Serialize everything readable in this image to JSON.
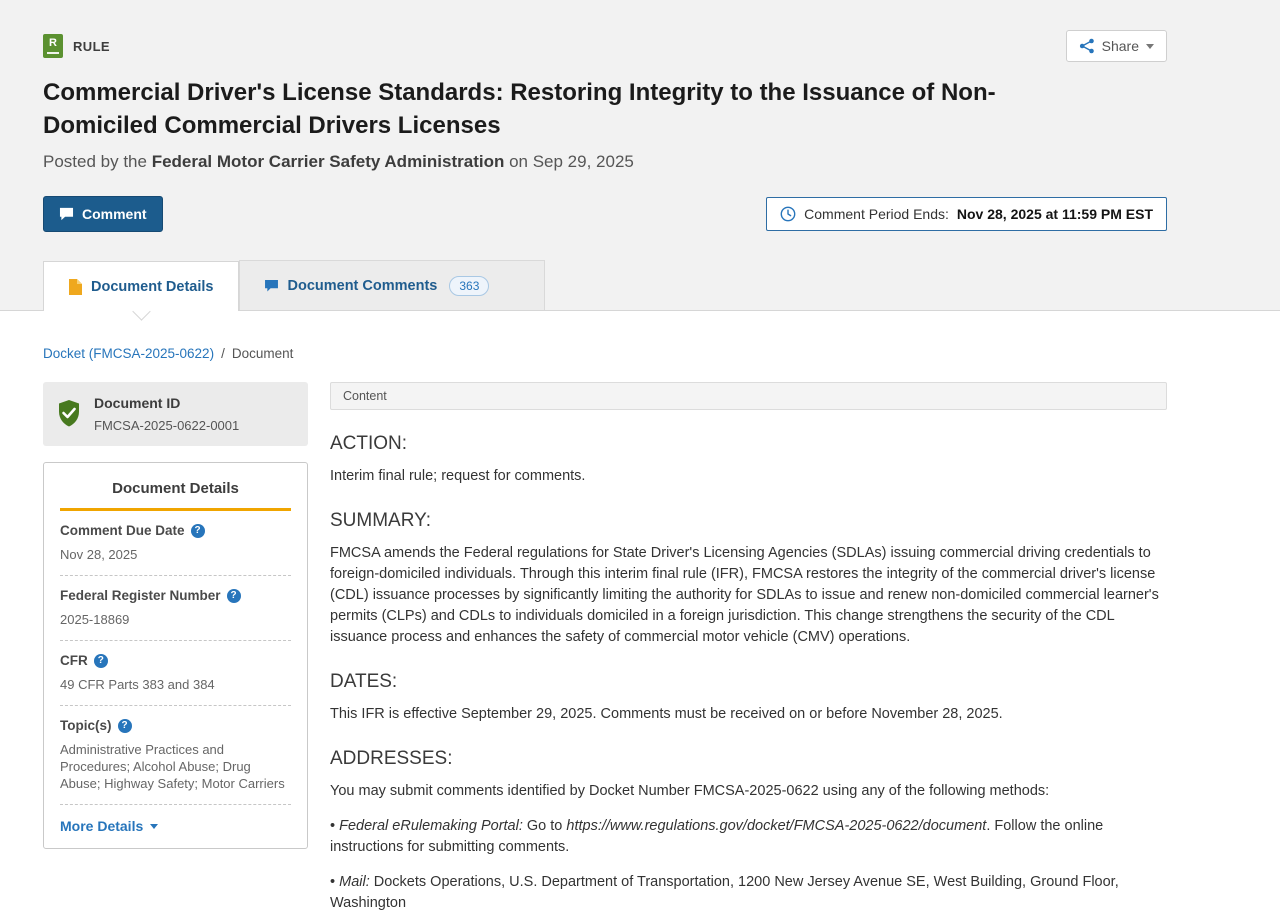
{
  "icons": {
    "help": "?"
  },
  "colors": {
    "accent_blue": "#2775bb",
    "comment_button_blue": "#1c5c8d",
    "rule_icon_green": "#5b9130",
    "shield_green": "#47791f",
    "tab_doc_icon_yellow": "#efa81e",
    "details_accent_orange": "#f0a500",
    "hero_background": "#f2f2f2"
  },
  "header": {
    "type_icon_letter": "R",
    "type_label": "RULE",
    "share_label": "Share",
    "title": "Commercial Driver's License Standards: Restoring Integrity to the Issuance of Non-Domiciled Commercial Drivers Licenses",
    "posted_prefix": "Posted by the ",
    "agency": "Federal Motor Carrier Safety Administration",
    "posted_suffix": " on Sep 29, 2025",
    "comment_button_label": "Comment",
    "comment_period_label": "Comment Period Ends:",
    "comment_period_value": "Nov 28, 2025 at 11:59 PM EST"
  },
  "tabs": {
    "details": {
      "label": "Document Details"
    },
    "comments": {
      "label": "Document Comments",
      "badge": "363"
    }
  },
  "breadcrumb": {
    "docket": "Docket (FMCSA-2025-0622)",
    "separator": "/",
    "current": "Document"
  },
  "sidebar": {
    "document_id": {
      "label": "Document ID",
      "value": "FMCSA-2025-0622-0001"
    },
    "details_title": "Document Details",
    "fields": [
      {
        "label": "Comment Due Date",
        "value": "Nov 28, 2025"
      },
      {
        "label": "Federal Register Number",
        "value": "2025-18869"
      },
      {
        "label": "CFR",
        "value": "49 CFR Parts 383 and 384"
      },
      {
        "label": "Topic(s)",
        "value": "Administrative Practices and Procedures; Alcohol Abuse; Drug Abuse; Highway Safety; Motor Carriers"
      }
    ],
    "more_details_label": "More Details"
  },
  "content": {
    "panel_title": "Content",
    "action": {
      "heading": "ACTION:",
      "body": "Interim final rule; request for comments."
    },
    "summary": {
      "heading": "SUMMARY:",
      "body": "FMCSA amends the Federal regulations for State Driver's Licensing Agencies (SDLAs) issuing commercial driving credentials to foreign-domiciled individuals. Through this interim final rule (IFR), FMCSA restores the integrity of the commercial driver's license (CDL) issuance processes by significantly limiting the authority for SDLAs to issue and renew non-domiciled commercial learner's permits (CLPs) and CDLs to individuals domiciled in a foreign jurisdiction. This change strengthens the security of the CDL issuance process and enhances the safety of commercial motor vehicle (CMV) operations."
    },
    "dates": {
      "heading": "DATES:",
      "body": "This IFR is effective September 29, 2025. Comments must be received on or before November 28, 2025."
    },
    "addresses": {
      "heading": "ADDRESSES:",
      "intro": "You may submit comments identified by Docket Number FMCSA-2025-0622 using any of the following methods:",
      "bullet1": {
        "marker": "• ",
        "term": "Federal eRulemaking Portal:",
        "mid": " Go to ",
        "url": "https://www.regulations.gov/docket/FMCSA-2025-0622/document",
        "rest": ". Follow the online instructions for submitting comments."
      },
      "bullet2": {
        "marker": "• ",
        "term": "Mail:",
        "rest": " Dockets Operations, U.S. Department of Transportation, 1200 New Jersey Avenue SE, West Building, Ground Floor, Washington"
      }
    }
  }
}
